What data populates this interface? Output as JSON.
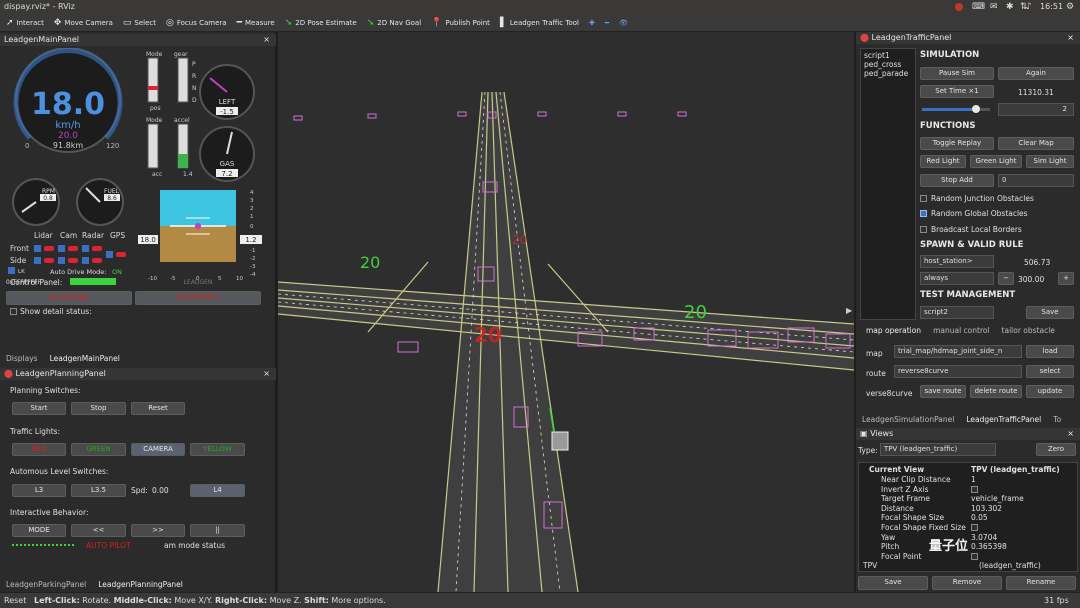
{
  "window": {
    "title": "dispay.rviz* - RViz",
    "clock": "16:51"
  },
  "toolbar": {
    "items": [
      {
        "icon": "cursor-icon",
        "label": "Interact"
      },
      {
        "icon": "move-icon",
        "label": "Move Camera"
      },
      {
        "icon": "select-icon",
        "label": "Select"
      },
      {
        "icon": "focus-icon",
        "label": "Focus Camera"
      },
      {
        "icon": "ruler-icon",
        "label": "Measure"
      },
      {
        "icon": "arrow-green-icon",
        "label": "2D Pose Estimate"
      },
      {
        "icon": "arrow-green-icon",
        "label": "2D Nav Goal"
      },
      {
        "icon": "pin-icon",
        "label": "Publish Point"
      },
      {
        "icon": "traffic-icon",
        "label": "Leadgen Traffic Tool"
      }
    ]
  },
  "main_panel": {
    "title": "LeadgenMainPanel",
    "speed": "18.0",
    "speed_unit": "km/h",
    "set_speed": "20.0",
    "odometer": "91.8km",
    "speed_min": "0",
    "speed_max": "120",
    "rpm_label": "RPM",
    "rpm_value": "0.8",
    "fuel_label": "FUEL",
    "fuel_value": "8.6",
    "left_label": "LEFT",
    "left_value": "-1.5",
    "gas_label": "GAS",
    "gas_value": "7.2",
    "mode_label": "Mode",
    "gear_label": "gear",
    "gear_letters": [
      "P",
      "R",
      "N",
      "D"
    ],
    "pos_label": "pos",
    "accel_label": "accel",
    "acc_label": "acc",
    "accel_value": "1.4",
    "attitude_left": "18.0",
    "attitude_right": "1.2",
    "attitude_scale": [
      "4",
      "3",
      "2",
      "1",
      "0",
      "-1",
      "-2",
      "-3",
      "-4"
    ],
    "attitude_ticks": [
      "-10",
      "-5",
      "0",
      "5",
      "10"
    ],
    "attitude_label": "LEADGEN",
    "sensor_cols": [
      "Lidar",
      "Cam",
      "Radar",
      "GPS"
    ],
    "row_front": "Front",
    "row_side": "Side",
    "lk_label": "LK",
    "hex": "0xFFFFFFFF",
    "auto_label": "Auto Drive Mode:",
    "auto_value": "ON",
    "control_panel": "Control Panel:",
    "stop_btn": "EG Engage",
    "reset_btn": "ELEVATOR E",
    "show_detail": "Show detail status:"
  },
  "left_tabs": [
    "Displays",
    "LeadgenMainPanel"
  ],
  "planning_panel": {
    "title": "LeadgenPlanningPanel",
    "switches_label": "Planning Switches:",
    "start": "Start",
    "stop": "Stop",
    "reset": "Reset",
    "traffic_label": "Traffic Lights:",
    "red": "RED",
    "green": "GREEN",
    "camera": "CAMERA",
    "yellow": "YELLOW",
    "level_label": "Automous Level Switches:",
    "l3": "L3",
    "l35": "L3.5",
    "spd_label": "Spd:",
    "spd_value": "0.00",
    "l4": "L4",
    "interactive_label": "Interactive Behavior:",
    "mode": "MODE",
    "prev": "<<",
    "next": ">>",
    "pause": "||",
    "status_red": "AUTO PILOT",
    "am_status": "am mode status"
  },
  "bottom_tabs": [
    "LeadgenParkingPanel",
    "LeadgenPlanningPanel"
  ],
  "viewport": {
    "speed_signs": [
      "20",
      "20",
      "20",
      "20"
    ]
  },
  "traffic_panel": {
    "title": "LeadgenTrafficPanel",
    "scripts": [
      "script1",
      "ped_cross",
      "ped_parade"
    ],
    "simulation": "SIMULATION",
    "pause_sim": "Pause Sim",
    "again": "Again",
    "set_time": "Set Time ×1",
    "time_value": "11310.31",
    "slider_value": "2",
    "functions": "FUNCTIONS",
    "toggle_replay": "Toggle Replay",
    "clear_map": "Clear Map",
    "red_light": "Red Light",
    "green_light": "Green Light",
    "sim_light": "Sim Light",
    "stop_add": "Stop Add",
    "stop_add_value": "0",
    "random_junction": "Random Junction Obstacles",
    "random_global": "Random Global Obstacles",
    "broadcast": "Broadcast Local Borders",
    "spawn": "SPAWN & VALID RULE",
    "host_station": "host_station>",
    "host_value": "506.73",
    "always": "always",
    "minus": "−",
    "always_value": "300.00",
    "plus": "+",
    "test_mgmt": "TEST MANAGEMENT",
    "script_field": "script2",
    "save": "Save"
  },
  "map_panel": {
    "tabs": [
      "map operation",
      "manual control",
      "tailor obstacle"
    ],
    "map_label": "map",
    "map_value": "trial_map/hdmap_joint_side_n",
    "load": "load",
    "route_label": "route",
    "route_value": "reverse8curve",
    "select": "select",
    "curve_label": "verse8curve",
    "save_route": "save route",
    "delete_route": "delete route",
    "update": "update"
  },
  "views_panel": {
    "tabs": [
      "LeadgenSimulationPanel",
      "LeadgenTrafficPanel",
      "To"
    ],
    "title": "Views",
    "type_label": "Type:",
    "type_value": "TPV (leadgen_traffic)",
    "zero": "Zero",
    "current_view": "Current View",
    "current_value": "TPV (leadgen_traffic)",
    "props": [
      {
        "k": "Near Clip Distance",
        "v": "1"
      },
      {
        "k": "Invert Z Axis",
        "v": ""
      },
      {
        "k": "Target Frame",
        "v": "vehicle_frame"
      },
      {
        "k": "Distance",
        "v": "103.302"
      },
      {
        "k": "Focal Shape Size",
        "v": "0.05"
      },
      {
        "k": "Focal Shape Fixed Size",
        "v": ""
      },
      {
        "k": "Yaw",
        "v": "3.0704"
      },
      {
        "k": "Pitch",
        "v": "0.365398"
      },
      {
        "k": "Focal Point",
        "v": ""
      }
    ],
    "tpv": "TPV",
    "tpv_value": "(leadgen_traffic)",
    "save": "Save",
    "remove": "Remove",
    "rename": "Rename",
    "watermark": "量子位"
  },
  "status": {
    "reset": "Reset",
    "hint_a": "Left-Click:",
    "hint_a_t": " Rotate. ",
    "hint_b": "Middle-Click:",
    "hint_b_t": " Move X/Y. ",
    "hint_c": "Right-Click:",
    "hint_c_t": " Move Z. ",
    "hint_d": "Shift:",
    "hint_d_t": " More options.",
    "fps": "31 fps"
  }
}
